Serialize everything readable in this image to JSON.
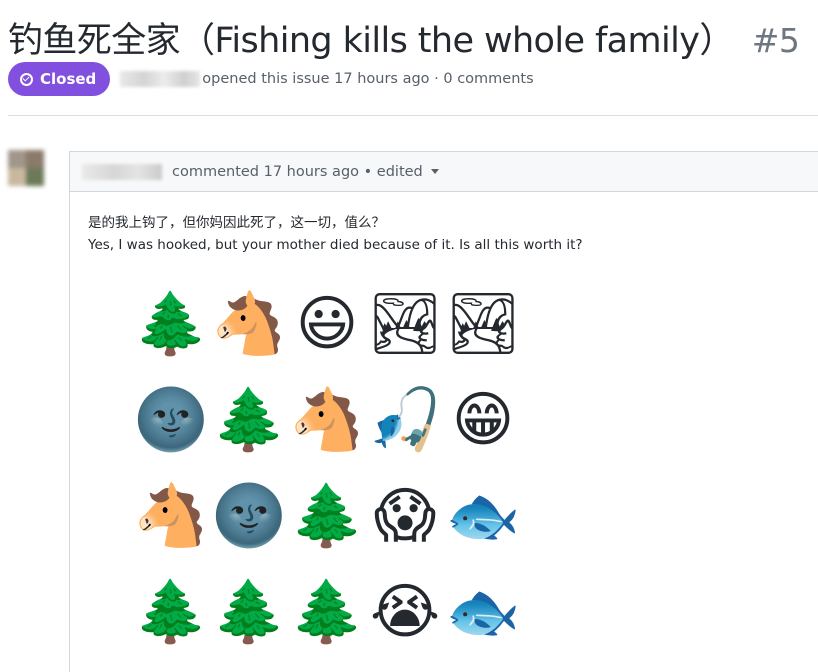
{
  "issue": {
    "title": "钓鱼死全家（Fishing kills the whole family）",
    "number": "#5",
    "state": "Closed",
    "meta_text": "opened this issue 17 hours ago · 0 comments"
  },
  "comment": {
    "meta_text": "commented 17 hours ago • edited",
    "line_zh": "是的我上钩了，但你妈因此死了，这一切，值么？",
    "line_en": "Yes, I was hooked, but your mother died because of it. Is all this worth it?",
    "emoji_rows": [
      [
        {
          "name": "evergreen-tree-icon",
          "char": "🌲"
        },
        {
          "name": "horse-face-icon",
          "char": "🐴"
        },
        {
          "name": "grinning-face-icon",
          "char": "😃"
        },
        {
          "name": "national-park-icon",
          "char": "🏞"
        },
        {
          "name": "national-park-icon",
          "char": "🏞"
        }
      ],
      [
        {
          "name": "new-moon-face-icon",
          "char": "🌚"
        },
        {
          "name": "evergreen-tree-icon",
          "char": "🌲"
        },
        {
          "name": "horse-face-icon",
          "char": "🐴"
        },
        {
          "name": "fishing-pole-icon",
          "char": "🎣"
        },
        {
          "name": "grinning-teeth-face-icon",
          "char": "😁"
        }
      ],
      [
        {
          "name": "horse-face-icon",
          "char": "🐴"
        },
        {
          "name": "new-moon-face-icon",
          "char": "🌚"
        },
        {
          "name": "evergreen-tree-icon",
          "char": "🌲"
        },
        {
          "name": "screaming-face-icon",
          "char": "😱"
        },
        {
          "name": "fish-icon",
          "char": "🐟"
        }
      ],
      [
        {
          "name": "evergreen-tree-icon",
          "char": "🌲"
        },
        {
          "name": "evergreen-tree-icon",
          "char": "🌲"
        },
        {
          "name": "evergreen-tree-icon",
          "char": "🌲"
        },
        {
          "name": "crying-face-icon",
          "char": "😭"
        },
        {
          "name": "fish-icon",
          "char": "🐟"
        }
      ]
    ]
  },
  "colors": {
    "closed_badge": "#8250df",
    "muted_text": "#57606a",
    "border": "#d0d7de",
    "header_bg": "#f6f8fa"
  }
}
